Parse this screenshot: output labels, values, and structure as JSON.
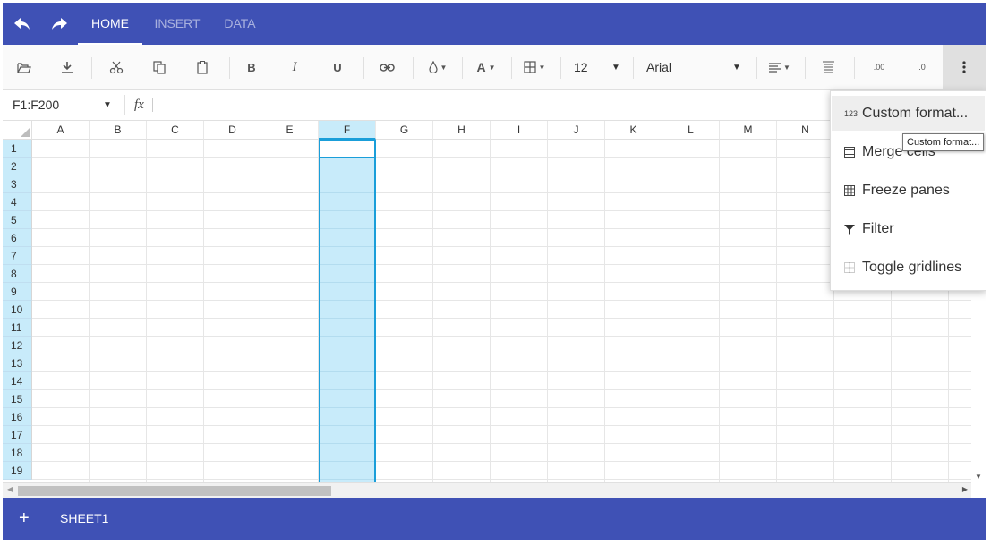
{
  "colors": {
    "primary": "#3f51b5",
    "selection": "#c8ebfa",
    "selection_border": "#1a9ed9"
  },
  "ribbon": {
    "tabs": [
      "HOME",
      "INSERT",
      "DATA"
    ],
    "active_tab": "HOME"
  },
  "toolbar": {
    "open_icon": "folder-open-icon",
    "save_icon": "download-icon",
    "cut_icon": "scissors-icon",
    "copy_icon": "copy-icon",
    "paste_icon": "clipboard-icon",
    "bold_label": "B",
    "italic_label": "I",
    "underline_label": "U",
    "hyperlink_icon": "link-icon",
    "fill_icon": "droplet-icon",
    "font_color_label": "A",
    "borders_icon": "grid-icon",
    "font_size": "12",
    "font_family": "Arial",
    "align_icon": "align-icon",
    "wrap_icon": "wrap-icon",
    "increase_decimal_label": ".00",
    "decrease_decimal_label": ".0",
    "more_icon": "vertical-dots-icon"
  },
  "formula_bar": {
    "name_box": "F1:F200",
    "fx_label": "fx",
    "value": ""
  },
  "grid": {
    "columns": [
      "A",
      "B",
      "C",
      "D",
      "E",
      "F",
      "G",
      "H",
      "I",
      "J",
      "K",
      "L",
      "M",
      "N"
    ],
    "rows": [
      "1",
      "2",
      "3",
      "4",
      "5",
      "6",
      "7",
      "8",
      "9",
      "10",
      "11",
      "12",
      "13",
      "14",
      "15",
      "16",
      "17",
      "18",
      "19"
    ],
    "selected_column": "F"
  },
  "menu": {
    "items": [
      {
        "icon_text": "123",
        "label": "Custom format..."
      },
      {
        "icon_text": "",
        "label": "Merge cells"
      },
      {
        "icon_text": "",
        "label": "Freeze panes"
      },
      {
        "icon_text": "",
        "label": "Filter"
      },
      {
        "icon_text": "",
        "label": "Toggle gridlines"
      }
    ],
    "tooltip": "Custom format..."
  },
  "sheets": {
    "add_label": "+",
    "tabs": [
      "SHEET1"
    ]
  }
}
